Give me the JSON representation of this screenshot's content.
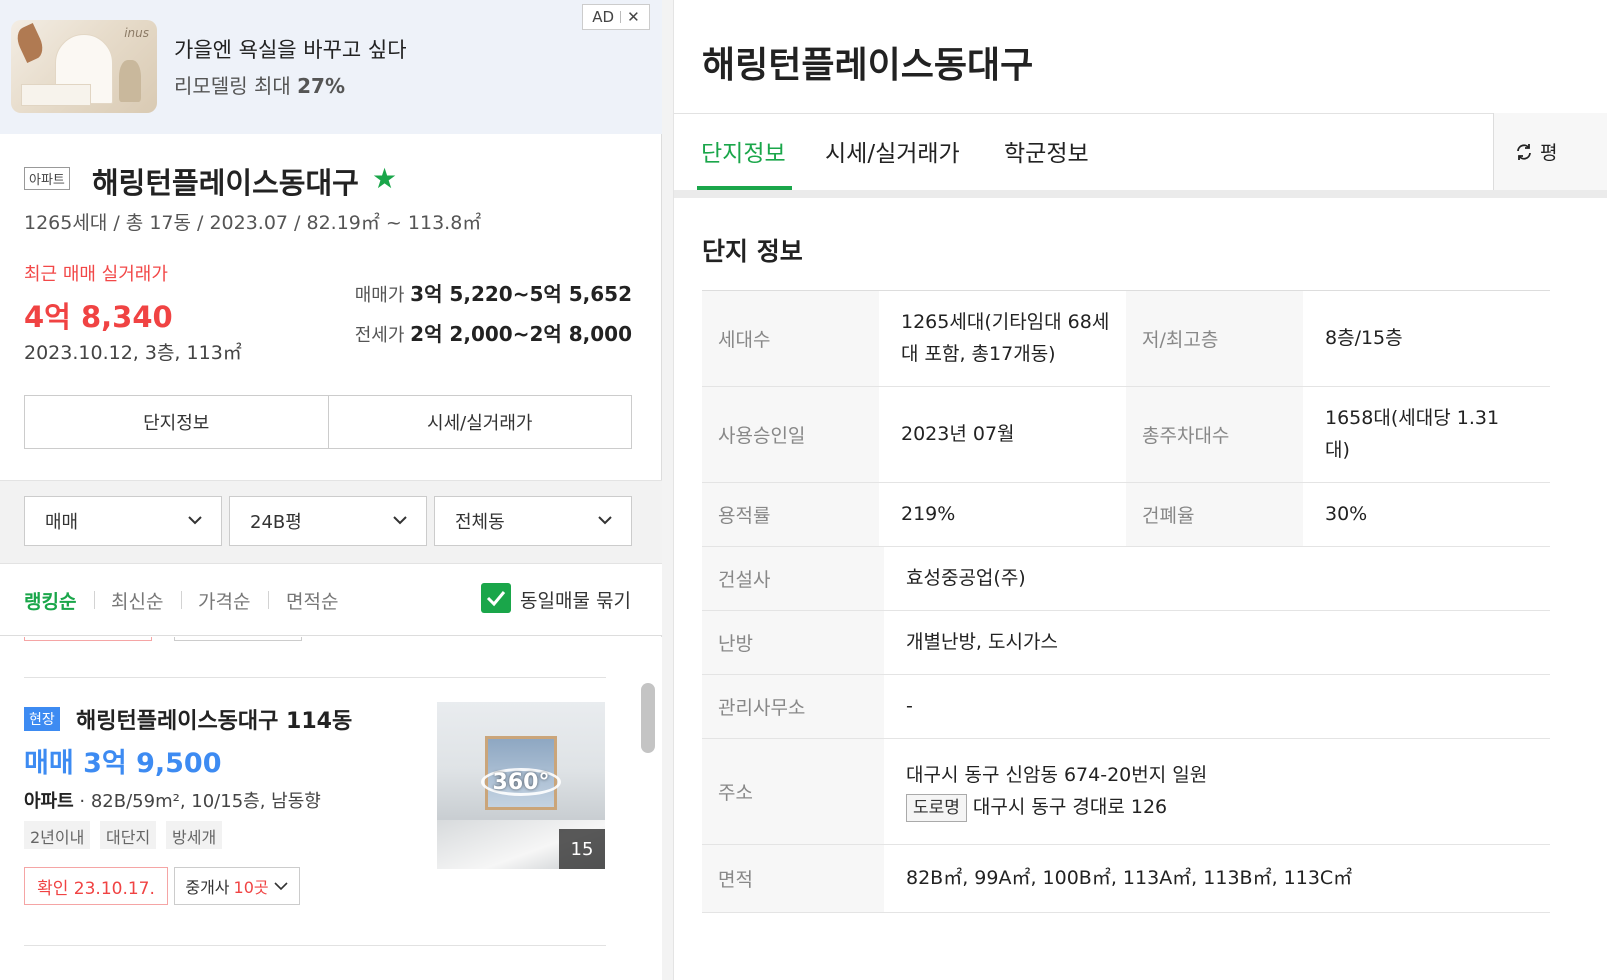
{
  "ad": {
    "brand": "inus",
    "title": "가을엔 욕실을 바꾸고 싶다",
    "subtitle": "리모델링 최대",
    "subtitle_pct": "27%",
    "badge": "AD",
    "close": "✕"
  },
  "complex": {
    "type_tag": "아파트",
    "name": "해링턴플레이스동대구",
    "favorite": "★",
    "meta": "1265세대 / 총 17동 / 2023.07 / 82.19㎡ ~ 113.8㎡",
    "recent_label": "최근 매매 실거래가",
    "recent_price": "4억 8,340",
    "recent_date": "2023.10.12, 3층, 113㎡",
    "sale_label": "매매가",
    "sale_range": "3억 5,220~5억 5,652",
    "jeonse_label": "전세가",
    "jeonse_range": "2억 2,000~2억 8,000",
    "buttons": [
      "단지정보",
      "시세/실거래가"
    ]
  },
  "filters": {
    "trade": "매매",
    "size": "24B평",
    "dong": "전체동"
  },
  "sort": {
    "options": [
      "랭킹순",
      "최신순",
      "가격순",
      "면적순"
    ],
    "active": "랭킹순",
    "group_label": "동일매물 묶기",
    "group_checked": true
  },
  "listing": {
    "tag": "현장",
    "title": "해링턴플레이스동대구 114동",
    "price": "매매 3억 9,500",
    "type": "아파트",
    "spec": " · 82B/59m², 10/15층, 남동향",
    "chips": [
      "2년이내",
      "대단지",
      "방세개"
    ],
    "confirm": "확인 23.10.17.",
    "broker_label": "중개사",
    "broker_count": "10곳",
    "photo_360": "360°",
    "photo_count": "15"
  },
  "detail": {
    "title": "해링턴플레이스동대구",
    "tabs": [
      "단지정보",
      "시세/실거래가",
      "학군정보"
    ],
    "active_tab": "단지정보",
    "unit_toggle": "평",
    "section_title": "단지 정보",
    "rows": [
      {
        "label": "세대수",
        "value_lines": [
          "1265세대(기타임대 68세",
          "대 포함, 총17개동)"
        ],
        "label2": "저/최고층",
        "value2_lines": [
          "8층/15층"
        ]
      },
      {
        "label": "사용승인일",
        "value_lines": [
          "2023년 07월"
        ],
        "label2": "총주차대수",
        "value2_lines": [
          "1658대(세대당 1.31",
          "대)"
        ]
      },
      {
        "label": "용적률",
        "value_lines": [
          "219%"
        ],
        "label2": "건폐율",
        "value2_lines": [
          "30%"
        ]
      },
      {
        "label": "건설사",
        "value_lines": [
          "효성중공업(주)"
        ]
      },
      {
        "label": "난방",
        "value_lines": [
          "개별난방, 도시가스"
        ]
      },
      {
        "label": "관리사무소",
        "value_lines": [
          "-"
        ]
      },
      {
        "label": "주소",
        "value_lines": [
          "대구시 동구 신암동 674-20번지 일원"
        ],
        "road_tag": "도로명",
        "road_address": "대구시 동구 경대로 126"
      },
      {
        "label": "면적",
        "value_lines": [
          "82B㎡, 99A㎡, 100B㎡, 113A㎡, 113B㎡, 113C㎡"
        ]
      }
    ]
  },
  "colors": {
    "green": "#1aa64a",
    "red": "#f04343",
    "blue": "#3d8bf2"
  }
}
